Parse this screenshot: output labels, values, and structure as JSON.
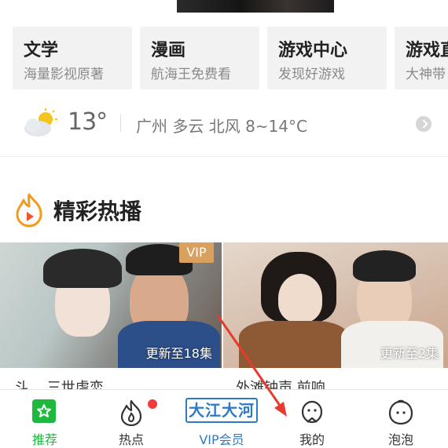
{
  "cards": [
    {
      "title": "文学",
      "subtitle": "海量影视原著"
    },
    {
      "title": "漫画",
      "subtitle": "航海王免费看"
    },
    {
      "title": "游戏中心",
      "subtitle": "发现好游戏"
    },
    {
      "title": "游戏直",
      "subtitle": "大神带"
    }
  ],
  "weather": {
    "temperature": "13°",
    "detail": "广州 多云 北风 8~14°C",
    "icon": "cloudy-sun-icon"
  },
  "section": {
    "title": "精彩热播",
    "icon": "fire-play-icon"
  },
  "thumbnails": [
    {
      "badge": "VIP",
      "update": "更新至18集",
      "title_partial": "斗… 三世虐恋"
    },
    {
      "update": "更新至2集",
      "title_partial": "外滩钟声  前响"
    }
  ],
  "tabbar": {
    "items": [
      {
        "label": "推荐",
        "icon": "star-home-icon",
        "active": true
      },
      {
        "label": "热点",
        "icon": "flame-icon",
        "has_dot": true
      },
      {
        "label": "VIP会员",
        "logo_text": "大江大河"
      },
      {
        "label": "我的",
        "icon": "penguin-profile-icon"
      },
      {
        "label": "泡泡",
        "icon": "bubble-face-icon"
      }
    ]
  },
  "colors": {
    "accent_green": "#1fb83f",
    "vip_blue": "#2e7ac7",
    "notification_red": "#f23a3a",
    "vip_badge": "#d9a15d",
    "annotation_arrow": "#e83a2e"
  }
}
